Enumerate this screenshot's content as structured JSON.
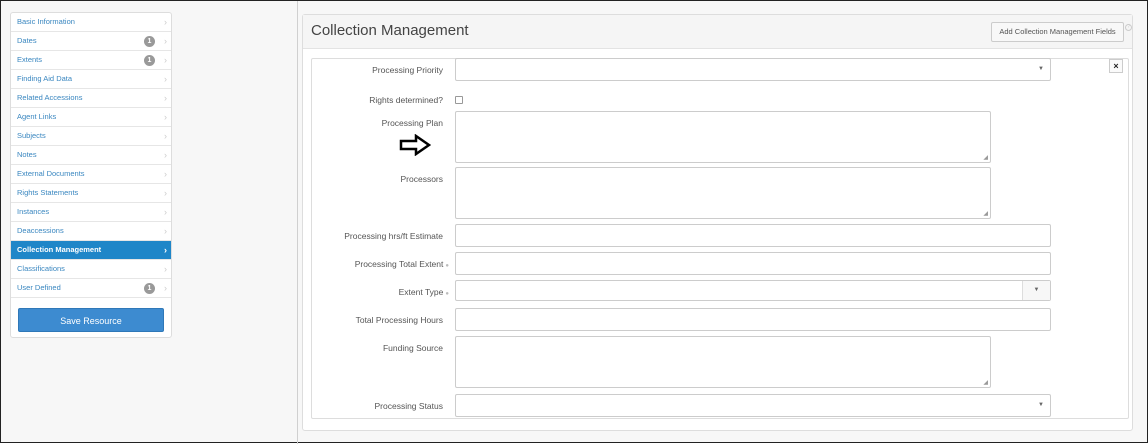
{
  "sidebar": {
    "items": [
      {
        "label": "Basic Information",
        "badge": ""
      },
      {
        "label": "Dates",
        "badge": "1"
      },
      {
        "label": "Extents",
        "badge": "1"
      },
      {
        "label": "Finding Aid Data",
        "badge": ""
      },
      {
        "label": "Related Accessions",
        "badge": ""
      },
      {
        "label": "Agent Links",
        "badge": ""
      },
      {
        "label": "Subjects",
        "badge": ""
      },
      {
        "label": "Notes",
        "badge": ""
      },
      {
        "label": "External Documents",
        "badge": ""
      },
      {
        "label": "Rights Statements",
        "badge": ""
      },
      {
        "label": "Instances",
        "badge": ""
      },
      {
        "label": "Deaccessions",
        "badge": ""
      },
      {
        "label": "Collection Management",
        "badge": ""
      },
      {
        "label": "Classifications",
        "badge": ""
      },
      {
        "label": "User Defined",
        "badge": "1"
      }
    ],
    "active_item": "Collection Management",
    "save_label": "Save Resource"
  },
  "main": {
    "title": "Collection Management",
    "add_button_label": "Add Collection Management Fields",
    "close_label": "×",
    "fields": {
      "processing_priority": {
        "label": "Processing Priority",
        "value": ""
      },
      "rights_determined": {
        "label": "Rights determined?",
        "checked": false
      },
      "processing_plan": {
        "label": "Processing Plan",
        "value": ""
      },
      "processors": {
        "label": "Processors",
        "value": ""
      },
      "hrs_estimate": {
        "label": "Processing hrs/ft Estimate",
        "value": ""
      },
      "total_extent": {
        "label": "Processing Total Extent",
        "value": ""
      },
      "extent_type": {
        "label": "Extent Type",
        "value": ""
      },
      "total_hours": {
        "label": "Total Processing Hours",
        "value": ""
      },
      "funding_source": {
        "label": "Funding Source",
        "value": ""
      },
      "processing_status": {
        "label": "Processing Status",
        "value": ""
      }
    }
  },
  "icons": {
    "chevron": "chevron-right-icon",
    "caret": "caret-down-icon",
    "arrow": "arrow-right-icon",
    "info": "info-icon"
  },
  "colors": {
    "accent": "#1f86c8",
    "link": "#3a87c0",
    "save_button": "#3d8bd0"
  }
}
